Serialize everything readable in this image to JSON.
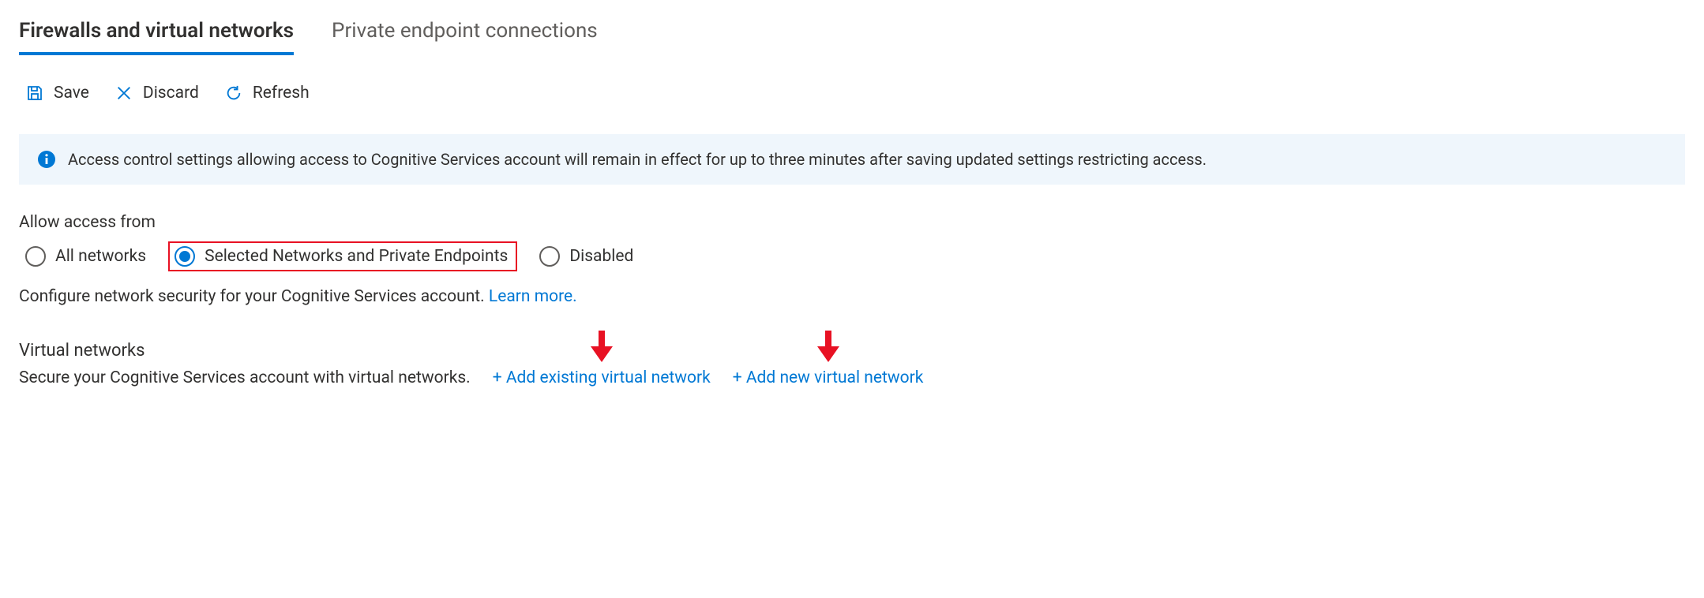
{
  "tabs": {
    "firewalls": "Firewalls and virtual networks",
    "private_endpoints": "Private endpoint connections"
  },
  "toolbar": {
    "save": "Save",
    "discard": "Discard",
    "refresh": "Refresh"
  },
  "info_banner": {
    "text": "Access control settings allowing access to Cognitive Services account will remain in effect for up to three minutes after saving updated settings restricting access."
  },
  "access_section": {
    "label": "Allow access from",
    "options": {
      "all": "All networks",
      "selected": "Selected Networks and Private Endpoints",
      "disabled": "Disabled"
    },
    "description": "Configure network security for your Cognitive Services account. ",
    "learn_more": "Learn more."
  },
  "vnet_section": {
    "heading": "Virtual networks",
    "description": "Secure your Cognitive Services account with virtual networks.",
    "add_existing": "+ Add existing virtual network",
    "add_new": "+ Add new virtual network"
  }
}
